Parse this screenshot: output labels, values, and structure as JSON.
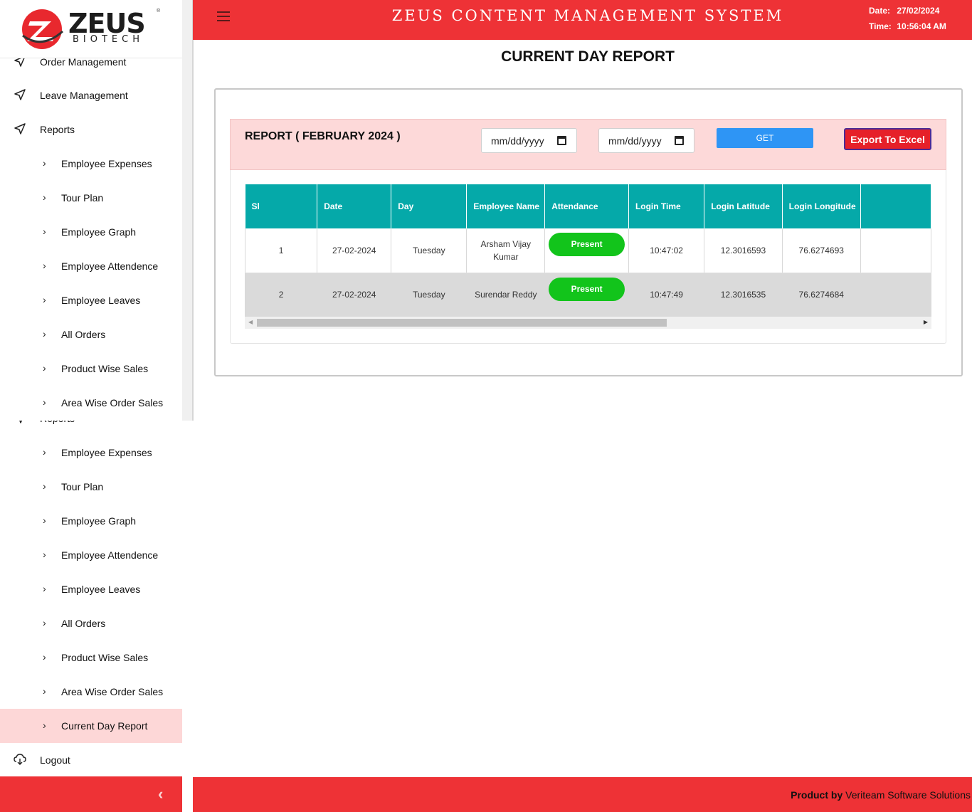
{
  "brand": {
    "name": "ZEUS",
    "sub": "BIOTECH",
    "reg": "®"
  },
  "header": {
    "title": "ZEUS CONTENT MANAGEMENT SYSTEM",
    "date_label": "Date:",
    "date_value": "27/02/2024",
    "time_label": "Time:",
    "time_value": "10:56:04 AM"
  },
  "sidebar": {
    "scrolled": {
      "order_management": "Order Management",
      "leave_management": "Leave Management",
      "reports": "Reports",
      "items": [
        "Employee Expenses",
        "Tour Plan",
        "Employee Graph",
        "Employee Attendence",
        "Employee Leaves",
        "All Orders",
        "Product Wise Sales",
        "Area Wise Order Sales"
      ]
    },
    "lower": {
      "reports": "Reports",
      "items": [
        "Employee Expenses",
        "Tour Plan",
        "Employee Graph",
        "Employee Attendence",
        "Employee Leaves",
        "All Orders",
        "Product Wise Sales",
        "Area Wise Order Sales",
        "Current Day Report"
      ],
      "logout": "Logout"
    }
  },
  "page": {
    "title": "CURRENT DAY REPORT",
    "report_title": "REPORT ( FEBRUARY 2024 )",
    "from_date_placeholder": "mm/dd/yyyy",
    "to_date_placeholder": "mm/dd/yyyy",
    "get_label": "GET",
    "export_label": "Export To Excel"
  },
  "table": {
    "columns": [
      "Sl",
      "Date",
      "Day",
      "Employee Name",
      "Attendance",
      "Login Time",
      "Login Latitude",
      "Login Longitude"
    ],
    "rows": [
      {
        "sl": "1",
        "date": "27-02-2024",
        "day": "Tuesday",
        "name_line1": "Arsham Vijay",
        "name_line2": "Kumar",
        "attendance": "Present",
        "login_time": "10:47:02",
        "lat": "12.3016593",
        "lng": "76.6274693"
      },
      {
        "sl": "2",
        "date": "27-02-2024",
        "day": "Tuesday",
        "name_line1": "Surendar Reddy",
        "name_line2": "",
        "attendance": "Present",
        "login_time": "10:47:49",
        "lat": "12.3016535",
        "lng": "76.6274684"
      }
    ]
  },
  "footer": {
    "product_by": "Product by",
    "company": "Veriteam Software Solutions"
  },
  "colors": {
    "brand_red": "#ee3236",
    "teal_header": "#05a9a9",
    "present_green": "#12c41b",
    "get_blue": "#2e95f5"
  }
}
